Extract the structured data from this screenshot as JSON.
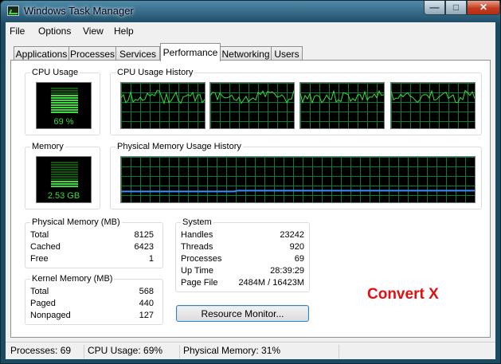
{
  "window": {
    "title": "Windows Task Manager"
  },
  "menu": [
    "File",
    "Options",
    "View",
    "Help"
  ],
  "tabs": [
    "Applications",
    "Processes",
    "Services",
    "Performance",
    "Networking",
    "Users"
  ],
  "active_tab": "Performance",
  "cpu_usage": {
    "label": "CPU Usage",
    "value": "69 %",
    "level": 0.69
  },
  "cpu_history": {
    "label": "CPU Usage History"
  },
  "memory": {
    "label": "Memory",
    "value": "2.53 GB",
    "level": 0.31
  },
  "memory_history": {
    "label": "Physical Memory Usage History"
  },
  "physical_memory": {
    "label": "Physical Memory (MB)",
    "rows": [
      {
        "name": "Total",
        "value": "8125"
      },
      {
        "name": "Cached",
        "value": "6423"
      },
      {
        "name": "Free",
        "value": "1"
      }
    ]
  },
  "kernel_memory": {
    "label": "Kernel Memory (MB)",
    "rows": [
      {
        "name": "Total",
        "value": "568"
      },
      {
        "name": "Paged",
        "value": "440"
      },
      {
        "name": "Nonpaged",
        "value": "127"
      }
    ]
  },
  "system": {
    "label": "System",
    "rows": [
      {
        "name": "Handles",
        "value": "23242"
      },
      {
        "name": "Threads",
        "value": "920"
      },
      {
        "name": "Processes",
        "value": "69"
      },
      {
        "name": "Up Time",
        "value": "28:39:29"
      },
      {
        "name": "Page File",
        "value": "2484M / 16423M"
      }
    ]
  },
  "resource_monitor_button": "Resource Monitor...",
  "watermark": "Convert X",
  "status": {
    "processes": "Processes: 69",
    "cpu": "CPU Usage: 69%",
    "memory": "Physical Memory: 31%"
  },
  "colors": {
    "graph_line": "#3bdc3b",
    "memory_line": "#3c8cff",
    "grid": "#0a7d3a",
    "watermark": "#e01010"
  }
}
